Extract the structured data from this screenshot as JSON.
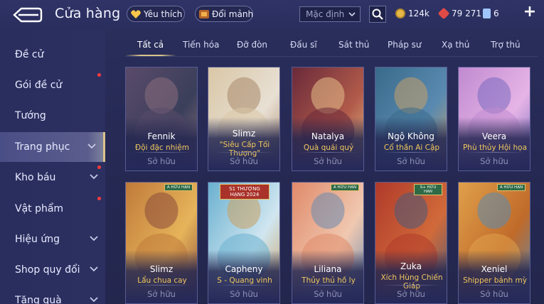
{
  "header": {
    "title": "Cửa hàng",
    "favorites_label": "Yêu thích",
    "exchange_label": "Đổi mảnh",
    "sort_value": "Mặc định",
    "currencies": [
      {
        "icon": "gold-coin-icon",
        "value": "124k",
        "color": "#e6b84a"
      },
      {
        "icon": "ruby-icon",
        "value": "79 271",
        "color": "#e04a45"
      },
      {
        "icon": "voucher-icon",
        "value": "6",
        "color": "#9fc5ff"
      }
    ],
    "add_label": "+"
  },
  "sidebar": {
    "items": [
      {
        "label": "Đề cử",
        "has_chevron": false,
        "dot": false
      },
      {
        "label": "Gói đề cử",
        "has_chevron": false,
        "dot": true
      },
      {
        "label": "Tướng",
        "has_chevron": false,
        "dot": false
      },
      {
        "label": "Trang phục",
        "has_chevron": true,
        "dot": false,
        "active": true
      },
      {
        "label": "Kho báu",
        "has_chevron": true,
        "dot": true
      },
      {
        "label": "Vật phẩm",
        "has_chevron": false,
        "dot": true
      },
      {
        "label": "Hiệu ứng",
        "has_chevron": true,
        "dot": false
      },
      {
        "label": "Shop quy đổi",
        "has_chevron": true,
        "dot": false
      },
      {
        "label": "Tặng quà",
        "has_chevron": true,
        "dot": false
      }
    ]
  },
  "tabs": [
    "Tất cả",
    "Tiến hóa",
    "Đỡ đòn",
    "Đấu sĩ",
    "Sát thủ",
    "Pháp sư",
    "Xạ thủ",
    "Trợ thủ"
  ],
  "cards": [
    {
      "hero": "Fennik",
      "skin": "Đội đặc nhiệm",
      "status": "Sở hữu",
      "palette": [
        "#5a4a6a",
        "#3a3f5a",
        "#8a6e7e"
      ]
    },
    {
      "hero": "Slimz",
      "skin": "\"Siêu Cấp Tối Thượng\"",
      "status": "Sở hữu",
      "palette": [
        "#d9c7a6",
        "#e8e0d4",
        "#a8886a"
      ]
    },
    {
      "hero": "Natalya",
      "skin": "Quà quái quỷ",
      "status": "Sở hữu",
      "palette": [
        "#6a2a3a",
        "#b05a4a",
        "#e6c08a"
      ]
    },
    {
      "hero": "Ngộ Không",
      "skin": "Cổ thần Ai Cập",
      "status": "Sở hữu",
      "palette": [
        "#3a6a8a",
        "#5a8ab0",
        "#c6a06a"
      ]
    },
    {
      "hero": "Veera",
      "skin": "Phù thủy Hội họa",
      "status": "Sở hữu",
      "palette": [
        "#c08ad0",
        "#e6b4e6",
        "#7a6ac0"
      ]
    },
    {
      "hero": "Slimz",
      "skin": "Lẩu chua cay",
      "status": "Sở hữu",
      "palette": [
        "#c07a3a",
        "#e6b45a",
        "#8a4a3a"
      ],
      "badge": "A HỮU HẠN"
    },
    {
      "hero": "Capheny",
      "skin": "S - Quang vinh",
      "status": "Sở hữu",
      "palette": [
        "#6ab0d0",
        "#d0e6f0",
        "#c9a060"
      ],
      "badge": "S1 THƯỢNG HẠNG 2024"
    },
    {
      "hero": "Liliana",
      "skin": "Thủy thủ hồ ly",
      "status": "Sở hữu",
      "palette": [
        "#e08a6a",
        "#f0c8b0",
        "#6a8ab0"
      ],
      "badge": "A HỮU HẠN"
    },
    {
      "hero": "Zuka",
      "skin": "Xích Hùng Chiến Giáp",
      "status": "Sở hữu",
      "palette": [
        "#b03a2a",
        "#d06a3a",
        "#4a5a7a"
      ],
      "badge": "S+ HỮU HẠN"
    },
    {
      "hero": "Xeniel",
      "skin": "Shipper bánh mỳ",
      "status": "Sở hữu",
      "palette": [
        "#e0a04a",
        "#c06a2a",
        "#5a8ab0"
      ],
      "badge": "A HỮU HẠN"
    }
  ]
}
